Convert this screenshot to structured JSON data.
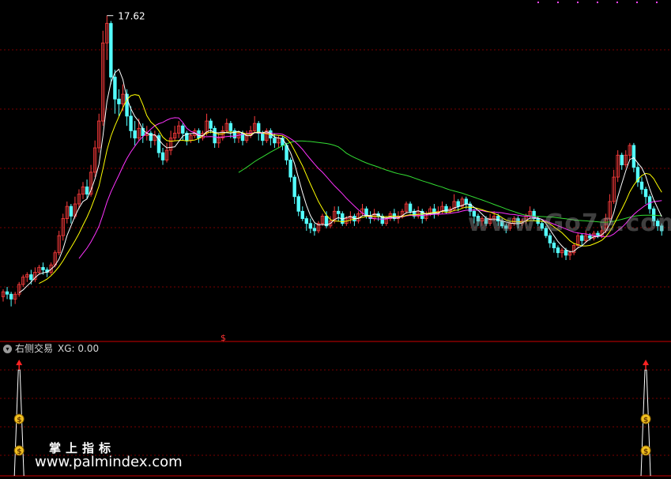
{
  "chart_data": {
    "type": "candlestick",
    "max_price_label": "17.62",
    "sub_indicator": {
      "name": "右侧交易",
      "field": "XG",
      "value": "0.00",
      "signal_bars": [
        4,
        161
      ]
    },
    "candles": [
      [
        6.1,
        6.3,
        6.4,
        5.9
      ],
      [
        6.3,
        6.2,
        6.5,
        6.0
      ],
      [
        6.2,
        6.0,
        6.3,
        5.7
      ],
      [
        6.0,
        6.2,
        6.3,
        5.8
      ],
      [
        6.2,
        6.6,
        6.7,
        6.1
      ],
      [
        6.6,
        6.9,
        7.0,
        6.5
      ],
      [
        6.9,
        7.0,
        7.1,
        6.7
      ],
      [
        7.0,
        6.8,
        7.2,
        6.6
      ],
      [
        6.8,
        7.1,
        7.3,
        6.7
      ],
      [
        7.1,
        7.3,
        7.4,
        7.0
      ],
      [
        7.3,
        7.2,
        7.5,
        7.0
      ],
      [
        7.2,
        7.1,
        7.3,
        6.9
      ],
      [
        7.1,
        7.4,
        7.5,
        7.0
      ],
      [
        7.4,
        7.9,
        8.0,
        7.3
      ],
      [
        7.9,
        8.6,
        8.8,
        7.8
      ],
      [
        8.6,
        9.3,
        9.5,
        8.4
      ],
      [
        9.3,
        9.8,
        10.0,
        9.1
      ],
      [
        9.8,
        9.4,
        9.9,
        9.1
      ],
      [
        9.4,
        9.9,
        10.2,
        9.3
      ],
      [
        9.9,
        10.3,
        10.5,
        9.7
      ],
      [
        10.3,
        10.6,
        10.8,
        10.1
      ],
      [
        10.6,
        10.3,
        10.9,
        10.1
      ],
      [
        10.3,
        11.2,
        11.5,
        10.2
      ],
      [
        11.2,
        12.2,
        12.5,
        11.0
      ],
      [
        12.2,
        13.3,
        13.6,
        12.0
      ],
      [
        13.3,
        16.5,
        17.0,
        13.1
      ],
      [
        16.5,
        17.3,
        17.62,
        15.8
      ],
      [
        17.3,
        15.1,
        17.4,
        14.8
      ],
      [
        15.1,
        14.2,
        15.4,
        13.6
      ],
      [
        14.2,
        14.0,
        14.6,
        13.5
      ],
      [
        14.0,
        14.4,
        14.8,
        13.7
      ],
      [
        14.4,
        13.5,
        14.6,
        13.1
      ],
      [
        13.5,
        12.9,
        13.9,
        12.6
      ],
      [
        12.9,
        12.6,
        13.3,
        12.3
      ],
      [
        12.6,
        13.0,
        13.4,
        12.5
      ],
      [
        13.0,
        12.7,
        13.2,
        12.4
      ],
      [
        12.7,
        12.8,
        13.1,
        12.5
      ],
      [
        12.8,
        12.5,
        12.9,
        12.2
      ],
      [
        12.5,
        12.7,
        12.9,
        12.3
      ],
      [
        12.7,
        12.0,
        12.8,
        11.8
      ],
      [
        12.0,
        11.7,
        12.2,
        11.5
      ],
      [
        11.7,
        12.1,
        12.4,
        11.6
      ],
      [
        12.1,
        12.6,
        12.9,
        11.9
      ],
      [
        12.6,
        12.8,
        13.1,
        12.5
      ],
      [
        12.8,
        13.1,
        13.3,
        12.6
      ],
      [
        13.1,
        12.8,
        13.2,
        12.5
      ],
      [
        12.8,
        12.5,
        12.9,
        12.3
      ],
      [
        12.5,
        12.7,
        12.8,
        12.4
      ],
      [
        12.7,
        12.9,
        13.0,
        12.6
      ],
      [
        12.9,
        12.6,
        13.0,
        12.4
      ],
      [
        12.6,
        12.8,
        12.9,
        12.5
      ],
      [
        12.8,
        13.3,
        13.6,
        12.7
      ],
      [
        13.3,
        13.0,
        13.4,
        12.8
      ],
      [
        13.0,
        12.4,
        13.1,
        12.2
      ],
      [
        12.4,
        12.6,
        12.8,
        12.2
      ],
      [
        12.6,
        12.9,
        13.1,
        12.5
      ],
      [
        12.9,
        13.2,
        13.4,
        12.8
      ],
      [
        13.2,
        12.9,
        13.3,
        12.6
      ],
      [
        12.9,
        12.6,
        13.0,
        12.4
      ],
      [
        12.6,
        12.8,
        12.9,
        12.4
      ],
      [
        12.8,
        12.5,
        12.9,
        12.3
      ],
      [
        12.5,
        12.7,
        12.9,
        12.4
      ],
      [
        12.7,
        12.9,
        13.1,
        12.6
      ],
      [
        12.9,
        13.2,
        13.5,
        12.8
      ],
      [
        13.2,
        12.8,
        13.3,
        12.5
      ],
      [
        12.8,
        12.5,
        12.9,
        12.3
      ],
      [
        12.5,
        12.9,
        13.0,
        12.4
      ],
      [
        12.9,
        12.6,
        13.0,
        12.3
      ],
      [
        12.6,
        12.4,
        12.8,
        12.2
      ],
      [
        12.4,
        12.6,
        12.7,
        12.2
      ],
      [
        12.6,
        12.3,
        12.7,
        12.1
      ],
      [
        12.3,
        11.7,
        12.4,
        11.5
      ],
      [
        11.7,
        11.0,
        11.8,
        10.8
      ],
      [
        11.0,
        10.2,
        11.1,
        9.9
      ],
      [
        10.2,
        9.6,
        10.3,
        9.4
      ],
      [
        9.6,
        9.3,
        9.8,
        9.2
      ],
      [
        9.3,
        9.1,
        9.4,
        8.8
      ],
      [
        9.1,
        8.9,
        9.3,
        8.7
      ],
      [
        8.9,
        8.8,
        9.1,
        8.6
      ],
      [
        8.8,
        9.1,
        9.2,
        8.7
      ],
      [
        9.1,
        9.4,
        9.5,
        9.0
      ],
      [
        9.4,
        9.0,
        9.6,
        8.9
      ],
      [
        9.0,
        9.2,
        9.4,
        8.9
      ],
      [
        9.2,
        9.6,
        9.8,
        9.1
      ],
      [
        9.6,
        9.5,
        9.8,
        9.2
      ],
      [
        9.5,
        9.1,
        9.6,
        9.0
      ],
      [
        9.1,
        9.3,
        9.4,
        9.0
      ],
      [
        9.3,
        9.4,
        9.6,
        9.1
      ],
      [
        9.4,
        9.2,
        9.5,
        9.0
      ],
      [
        9.2,
        9.5,
        9.6,
        9.1
      ],
      [
        9.5,
        9.7,
        9.9,
        9.4
      ],
      [
        9.7,
        9.4,
        9.8,
        9.3
      ],
      [
        9.4,
        9.3,
        9.6,
        9.1
      ],
      [
        9.3,
        9.5,
        9.7,
        9.2
      ],
      [
        9.5,
        9.4,
        9.6,
        9.2
      ],
      [
        9.4,
        9.1,
        9.5,
        9.0
      ],
      [
        9.1,
        9.3,
        9.4,
        9.0
      ],
      [
        9.3,
        9.5,
        9.6,
        9.2
      ],
      [
        9.5,
        9.3,
        9.7,
        9.2
      ],
      [
        9.3,
        9.4,
        9.6,
        9.1
      ],
      [
        9.4,
        9.6,
        9.7,
        9.3
      ],
      [
        9.6,
        9.9,
        10.0,
        9.5
      ],
      [
        9.9,
        9.6,
        10.0,
        9.5
      ],
      [
        9.6,
        9.4,
        9.7,
        9.3
      ],
      [
        9.4,
        9.6,
        9.8,
        9.3
      ],
      [
        9.6,
        9.3,
        9.7,
        9.1
      ],
      [
        9.3,
        9.5,
        9.6,
        9.2
      ],
      [
        9.5,
        9.7,
        9.8,
        9.4
      ],
      [
        9.7,
        9.5,
        9.9,
        9.3
      ],
      [
        9.5,
        9.6,
        9.8,
        9.4
      ],
      [
        9.6,
        9.8,
        10.0,
        9.5
      ],
      [
        9.8,
        9.6,
        9.9,
        9.5
      ],
      [
        9.6,
        9.7,
        9.8,
        9.5
      ],
      [
        9.7,
        10.0,
        10.3,
        9.6
      ],
      [
        10.0,
        9.8,
        10.1,
        9.6
      ],
      [
        9.8,
        10.1,
        10.2,
        9.7
      ],
      [
        10.1,
        9.9,
        10.2,
        9.7
      ],
      [
        9.9,
        9.6,
        10.0,
        9.4
      ],
      [
        9.6,
        9.4,
        9.7,
        9.1
      ],
      [
        9.4,
        9.2,
        9.5,
        9.0
      ],
      [
        9.2,
        9.3,
        9.4,
        9.0
      ],
      [
        9.3,
        9.1,
        9.4,
        9.0
      ],
      [
        9.1,
        9.3,
        9.5,
        9.0
      ],
      [
        9.3,
        9.4,
        9.6,
        9.2
      ],
      [
        9.4,
        9.2,
        9.5,
        9.0
      ],
      [
        9.2,
        9.0,
        9.3,
        8.9
      ],
      [
        9.0,
        8.9,
        9.1,
        8.7
      ],
      [
        8.9,
        9.1,
        9.2,
        8.8
      ],
      [
        9.1,
        9.3,
        9.4,
        9.0
      ],
      [
        9.3,
        9.1,
        9.4,
        8.9
      ],
      [
        9.1,
        9.2,
        9.3,
        9.0
      ],
      [
        9.2,
        9.4,
        9.5,
        9.1
      ],
      [
        9.4,
        9.6,
        9.8,
        9.3
      ],
      [
        9.6,
        9.3,
        9.7,
        9.2
      ],
      [
        9.3,
        9.1,
        9.4,
        9.0
      ],
      [
        9.1,
        8.9,
        9.2,
        8.8
      ],
      [
        8.9,
        8.6,
        9.0,
        8.5
      ],
      [
        8.6,
        8.3,
        8.7,
        8.1
      ],
      [
        8.3,
        8.1,
        8.4,
        7.9
      ],
      [
        8.1,
        7.9,
        8.2,
        7.7
      ],
      [
        7.9,
        8.0,
        8.1,
        7.7
      ],
      [
        8.0,
        7.8,
        8.1,
        7.6
      ],
      [
        7.8,
        7.9,
        8.0,
        7.6
      ],
      [
        7.9,
        8.2,
        8.3,
        7.8
      ],
      [
        8.2,
        8.6,
        8.7,
        8.1
      ],
      [
        8.6,
        8.4,
        8.7,
        8.2
      ],
      [
        8.4,
        8.6,
        8.8,
        8.3
      ],
      [
        8.6,
        8.5,
        8.7,
        8.4
      ],
      [
        8.5,
        8.7,
        8.8,
        8.4
      ],
      [
        8.7,
        8.6,
        8.8,
        8.5
      ],
      [
        8.6,
        8.8,
        9.0,
        8.5
      ],
      [
        8.8,
        9.3,
        9.5,
        8.7
      ],
      [
        9.3,
        10.0,
        10.3,
        9.2
      ],
      [
        10.0,
        11.0,
        11.3,
        9.9
      ],
      [
        11.0,
        11.9,
        12.1,
        10.8
      ],
      [
        11.9,
        11.5,
        12.0,
        11.3
      ],
      [
        11.5,
        11.9,
        12.1,
        11.4
      ],
      [
        11.9,
        12.3,
        12.4,
        11.7
      ],
      [
        12.3,
        11.4,
        12.4,
        11.2
      ],
      [
        11.4,
        10.8,
        11.6,
        10.6
      ],
      [
        10.8,
        10.5,
        11.0,
        10.3
      ],
      [
        10.5,
        10.2,
        10.6,
        9.9
      ],
      [
        10.2,
        9.7,
        10.3,
        9.5
      ],
      [
        9.7,
        9.2,
        9.8,
        9.0
      ],
      [
        9.2,
        9.0,
        9.3,
        8.8
      ],
      [
        9.0,
        8.8,
        9.1,
        8.6
      ]
    ],
    "ylim": [
      5.3,
      18.0
    ],
    "colors": {
      "up": "#ff3c3c",
      "down": "#54ffff",
      "ma5": "#ffffff",
      "ma10": "#ffff00",
      "ma20": "#ff33ff",
      "ma60": "#33dd33",
      "grid": "#7a0000"
    }
  },
  "watermark": {
    "cn": "掌上指标",
    "url": "www.palmindex.com",
    "overlay": "www.Go7e.com"
  }
}
